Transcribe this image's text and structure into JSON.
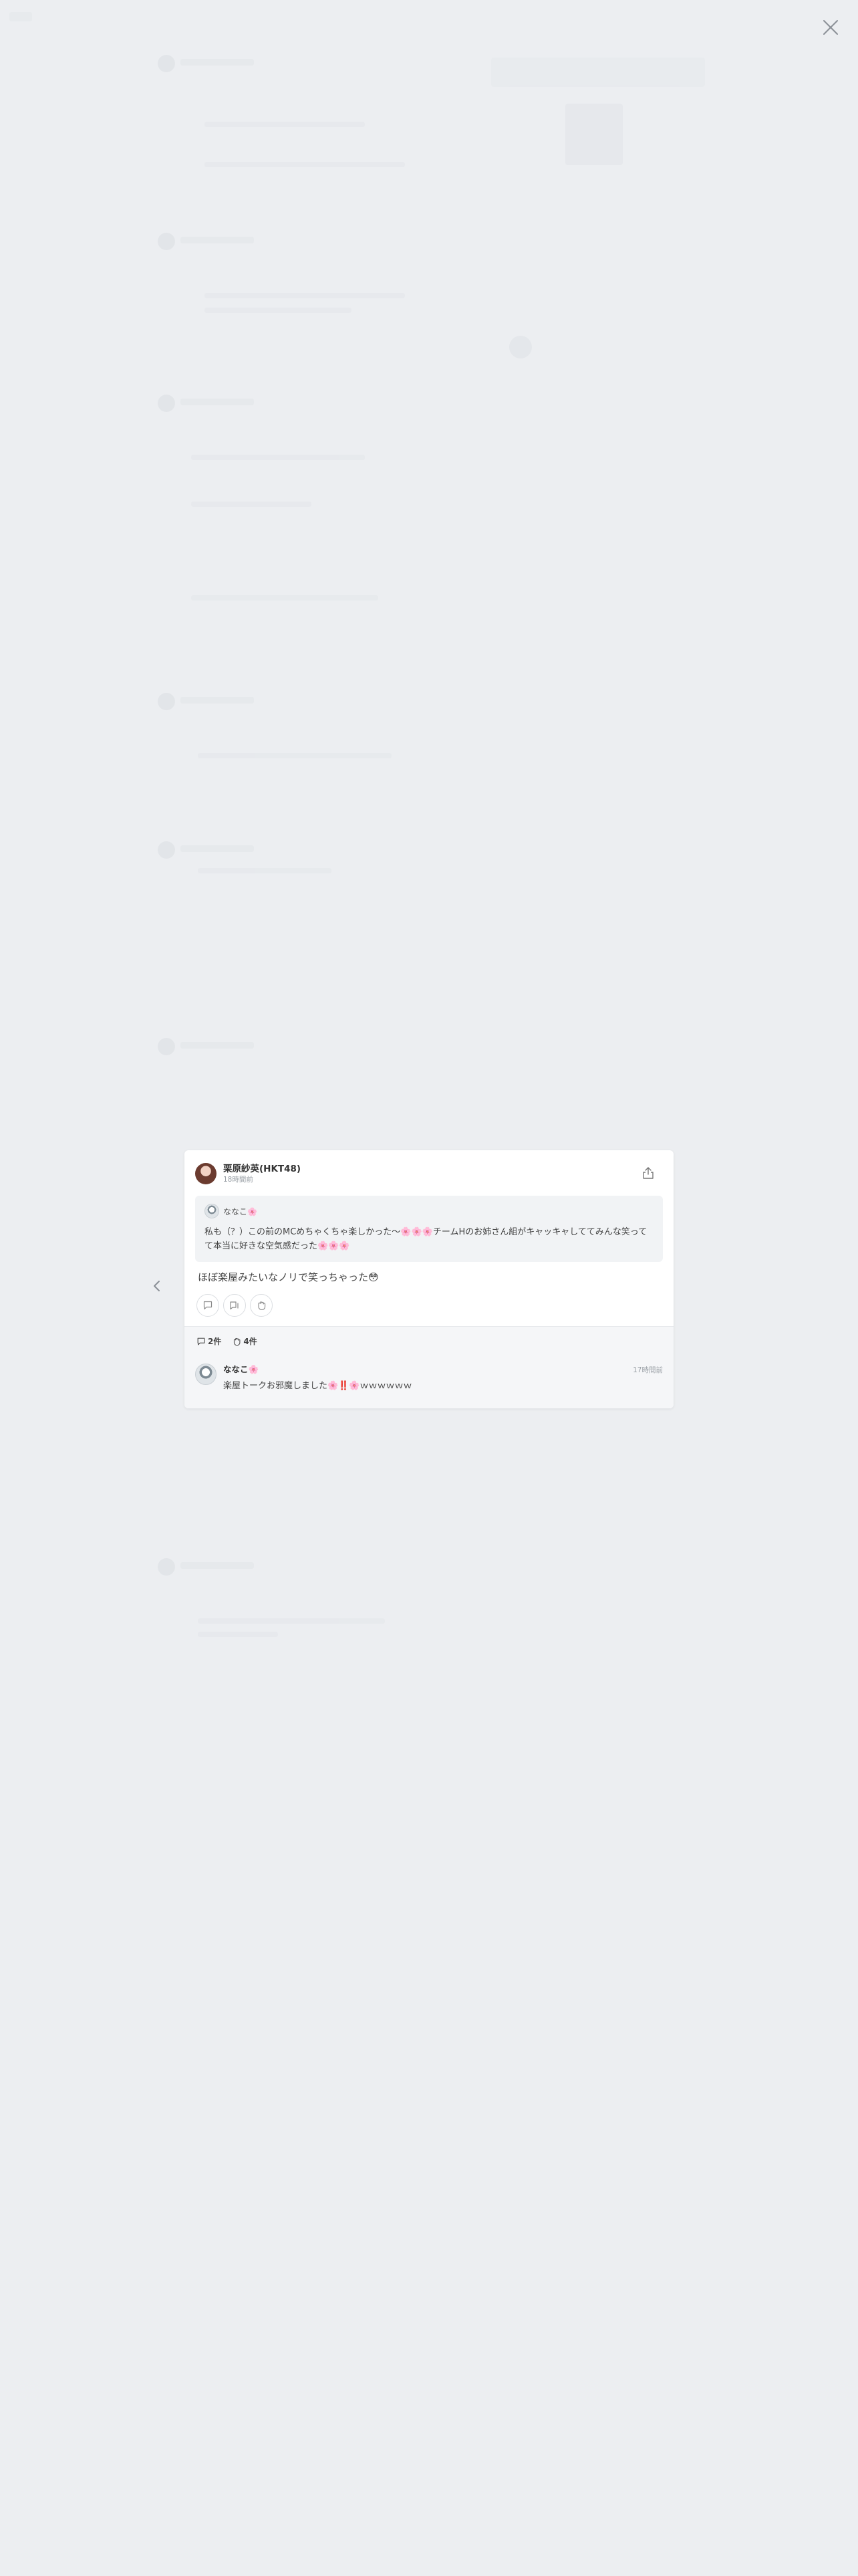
{
  "post": {
    "author_name": "栗原紗英(HKT48)",
    "time": "18時間前",
    "body": "ほぼ楽屋みたいなノリで笑っちゃった😳"
  },
  "quote": {
    "name": "ななこ🌸",
    "text": "私も（？）この前のMCめちゃくちゃ楽しかった〜🌸🌸🌸チームHのお姉さん組がキャッキャしててみんな笑ってて本当に好きな空気感だった🌸🌸🌸"
  },
  "stats": {
    "comments": "2件",
    "likes": "4件"
  },
  "comment": {
    "name": "ななこ🌸",
    "time": "17時間前",
    "text": "楽屋トークお邪魔しました🌸‼️🌸ｗｗｗｗｗｗ"
  },
  "icons": {
    "close": "close-icon",
    "share": "share-icon",
    "prev": "chevron-left-icon",
    "comment": "comment-icon",
    "quote": "quote-icon",
    "like": "hand-clap-icon"
  },
  "colors": {
    "backdrop": "#eceef1",
    "card": "#ffffff",
    "quote_bg": "#f1f3f5",
    "footer_bg": "#f5f6f8"
  }
}
